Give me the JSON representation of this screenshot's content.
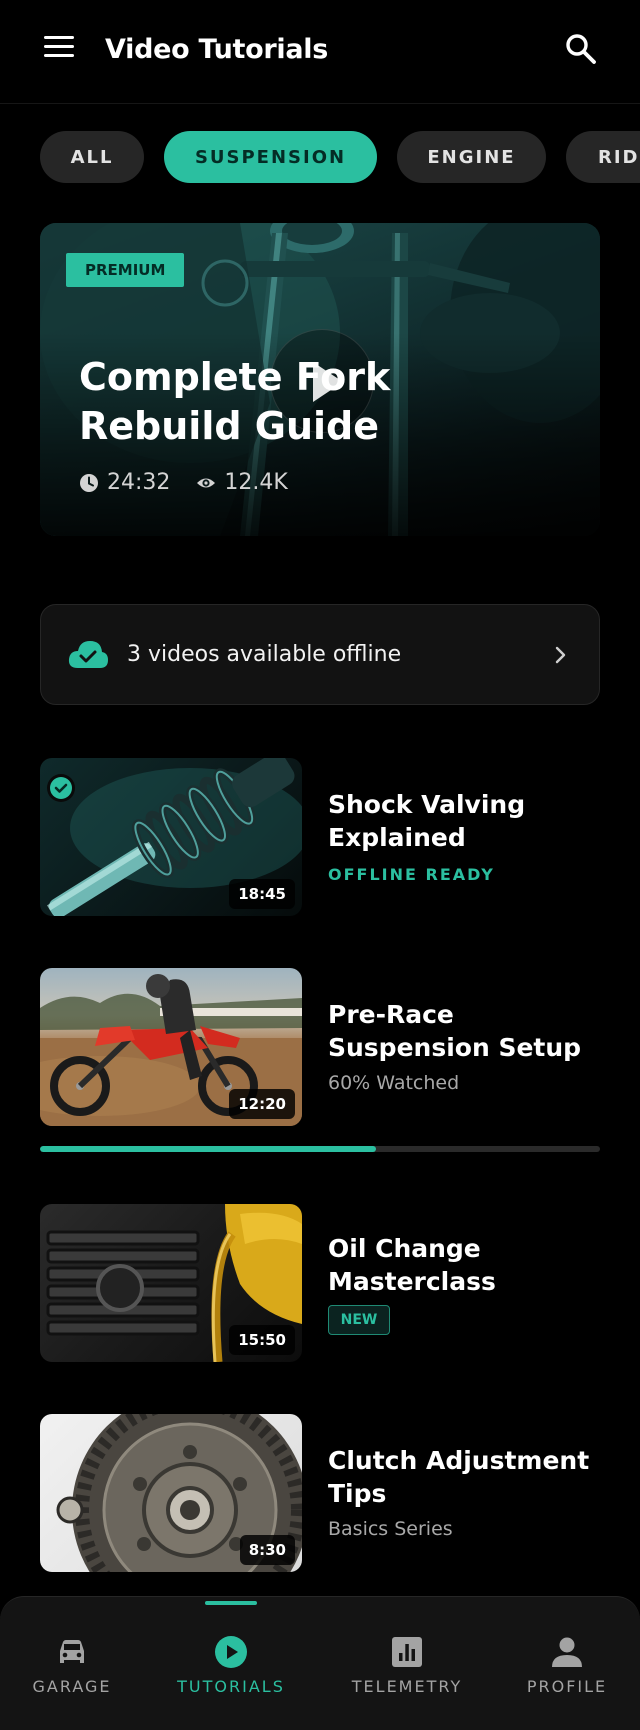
{
  "header": {
    "title": "Video Tutorials",
    "menu_icon": "menu-icon",
    "search_icon": "search-icon"
  },
  "filters": {
    "chips": [
      "ALL",
      "SUSPENSION",
      "ENGINE",
      "RIDI"
    ],
    "selected": "SUSPENSION"
  },
  "featured": {
    "badge": "PREMIUM",
    "title": "Complete Fork Rebuild Guide",
    "duration": "24:32",
    "views": "12.4K",
    "icons": [
      "clock-icon",
      "eye-icon",
      "play-icon"
    ]
  },
  "offline_banner": {
    "text": "3 videos available offline",
    "icons": [
      "cloud-check-icon",
      "chevron-right-icon"
    ]
  },
  "videos": [
    {
      "title": "Shock Valving Explained",
      "subtitle": "OFFLINE READY",
      "duration": "18:45",
      "downloaded": true
    },
    {
      "title": "Pre-Race Suspension Setup",
      "subtitle": "60% Watched",
      "duration": "12:20",
      "progress": 0.6
    },
    {
      "title": "Oil Change Masterclass",
      "badge": "NEW",
      "duration": "15:50"
    },
    {
      "title": "Clutch Adjustment Tips",
      "subtitle": "Basics Series",
      "duration": "8:30"
    }
  ],
  "nav": {
    "items": [
      {
        "label": "GARAGE",
        "icon": "car-icon"
      },
      {
        "label": "TUTORIALS",
        "icon": "play-circle-icon"
      },
      {
        "label": "TELEMETRY",
        "icon": "bar-chart-icon"
      },
      {
        "label": "PROFILE",
        "icon": "person-icon"
      }
    ],
    "active": "TUTORIALS"
  },
  "colors": {
    "accent": "#2bbfa0",
    "background": "#000000",
    "surface": "#121212",
    "chip": "#262626"
  }
}
